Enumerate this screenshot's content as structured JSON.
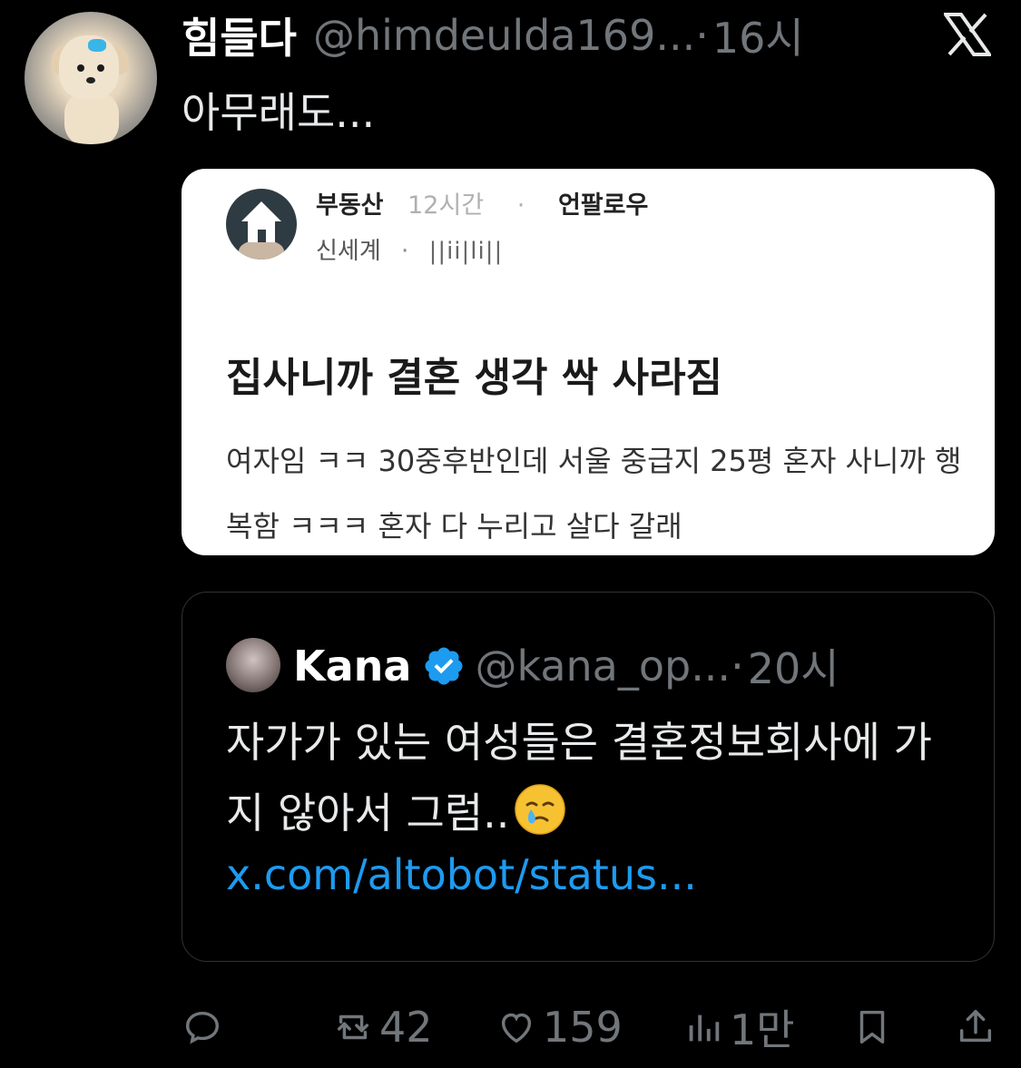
{
  "tweet": {
    "display_name": "힘들다",
    "handle": "@himdeulda169...",
    "dot": "·",
    "time": "16시",
    "text": "아무래도...",
    "avatar_icon": "puppy-avatar",
    "platform_icon": "x-logo-icon"
  },
  "image_card": {
    "board": "부동산",
    "posted_ago": "12시간",
    "separator": "·",
    "follow_label": "언팔로우",
    "company": "신세계",
    "nickname": "||ii|li||",
    "title": "집사니까 결혼 생각 싹 사라짐",
    "body": "여자임 ㅋㅋ 30중후반인데 서울 중급지 25평 혼자 사니까 행복함 ㅋㅋㅋ 혼자 다 누리고 살다 갈래"
  },
  "quote_tweet": {
    "display_name": "Kana",
    "verified_icon": "verified-badge-icon",
    "handle": "@kana_op...",
    "dot": "·",
    "time": "20시",
    "text": "자가가 있는 여성들은 결혼정보회사에 가지 않아서 그럼..",
    "emoji": "face-holding-back-tears",
    "link": "x.com/altobot/status..."
  },
  "actions": {
    "reply_count": "",
    "retweet_count": "42",
    "like_count": "159",
    "views_count": "1만"
  },
  "colors": {
    "background": "#000000",
    "text": "#e7e9ea",
    "muted": "#71767b",
    "link": "#1d9bf0",
    "verified": "#1d9bf0",
    "border": "#2f3336"
  }
}
